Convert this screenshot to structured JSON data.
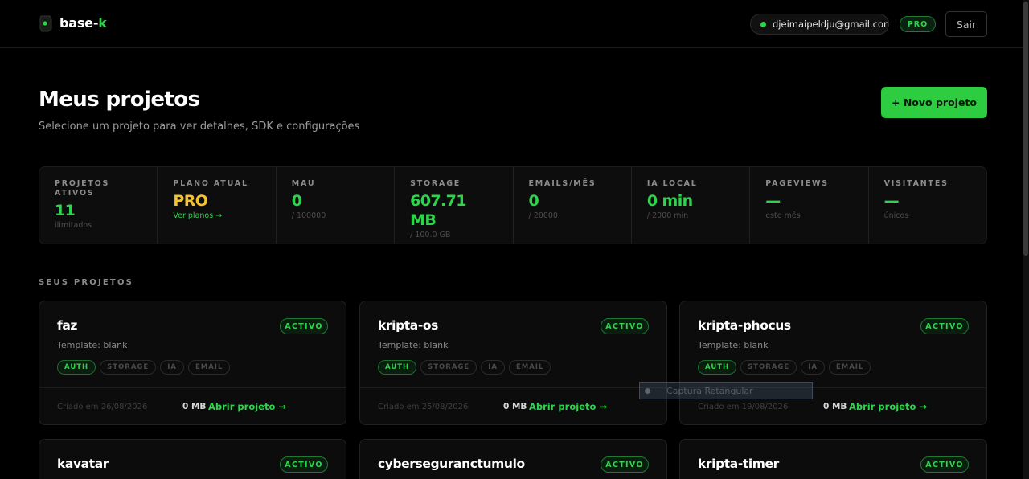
{
  "header": {
    "logo_icon": "base-k-logo-icon",
    "logo_prefix": "base-",
    "logo_suffix": "k",
    "email": "djeimaipeldju@gmail.com",
    "plan_badge": "PRO",
    "logout_label": "Sair"
  },
  "page": {
    "title": "Meus projetos",
    "subtitle": "Selecione um projeto para ver detalhes, SDK e configurações",
    "new_project_label": "+ Novo projeto"
  },
  "stats": [
    {
      "label": "PROJETOS ATIVOS",
      "value": "11",
      "sub": "ilimitados",
      "color": "#2fd34d"
    },
    {
      "label": "PLANO ATUAL",
      "value": "PRO",
      "link": "Ver planos →",
      "color": "#f2c230"
    },
    {
      "label": "MAU",
      "value": "0",
      "sub": "/ 100000",
      "color": "#2fd34d"
    },
    {
      "label": "STORAGE",
      "value": "607.71 MB",
      "sub": "/ 100.0 GB",
      "color": "#2fd34d"
    },
    {
      "label": "EMAILS/MÊS",
      "value": "0",
      "sub": "/ 20000",
      "color": "#2fd34d"
    },
    {
      "label": "IA LOCAL",
      "value": "0 min",
      "sub": "/ 2000 min",
      "color": "#2fd34d"
    },
    {
      "label": "PAGEVIEWS",
      "value": "—",
      "sub": "este mês",
      "color": "#2fd34d"
    },
    {
      "label": "VISITANTES",
      "value": "—",
      "sub": "únicos",
      "color": "#2fd34d"
    }
  ],
  "projects_section_label": "SEUS PROJETOS",
  "projects": [
    {
      "name": "faz",
      "status": "ACTIVO",
      "template": "Template: blank",
      "tags": [
        "AUTH",
        "STORAGE",
        "IA",
        "EMAIL"
      ],
      "active_tags": [
        "AUTH"
      ],
      "created": "Criado em 26/08/2026",
      "size": "0 MB",
      "open_label": "Abrir projeto →"
    },
    {
      "name": "kripta-os",
      "status": "ACTIVO",
      "template": "Template: blank",
      "tags": [
        "AUTH",
        "STORAGE",
        "IA",
        "EMAIL"
      ],
      "active_tags": [
        "AUTH"
      ],
      "created": "Criado em 25/08/2026",
      "size": "0 MB",
      "open_label": "Abrir projeto →"
    },
    {
      "name": "kripta-phocus",
      "status": "ACTIVO",
      "template": "Template: blank",
      "tags": [
        "AUTH",
        "STORAGE",
        "IA",
        "EMAIL"
      ],
      "active_tags": [
        "AUTH"
      ],
      "created": "Criado em 19/08/2026",
      "size": "0 MB",
      "open_label": "Abrir projeto →"
    },
    {
      "name": "kavatar",
      "status": "ACTIVO"
    },
    {
      "name": "cyberseguranctumulo",
      "status": "ACTIVO"
    },
    {
      "name": "kripta-timer",
      "status": "ACTIVO"
    }
  ],
  "overlay": {
    "label": "Captura Retangular"
  }
}
